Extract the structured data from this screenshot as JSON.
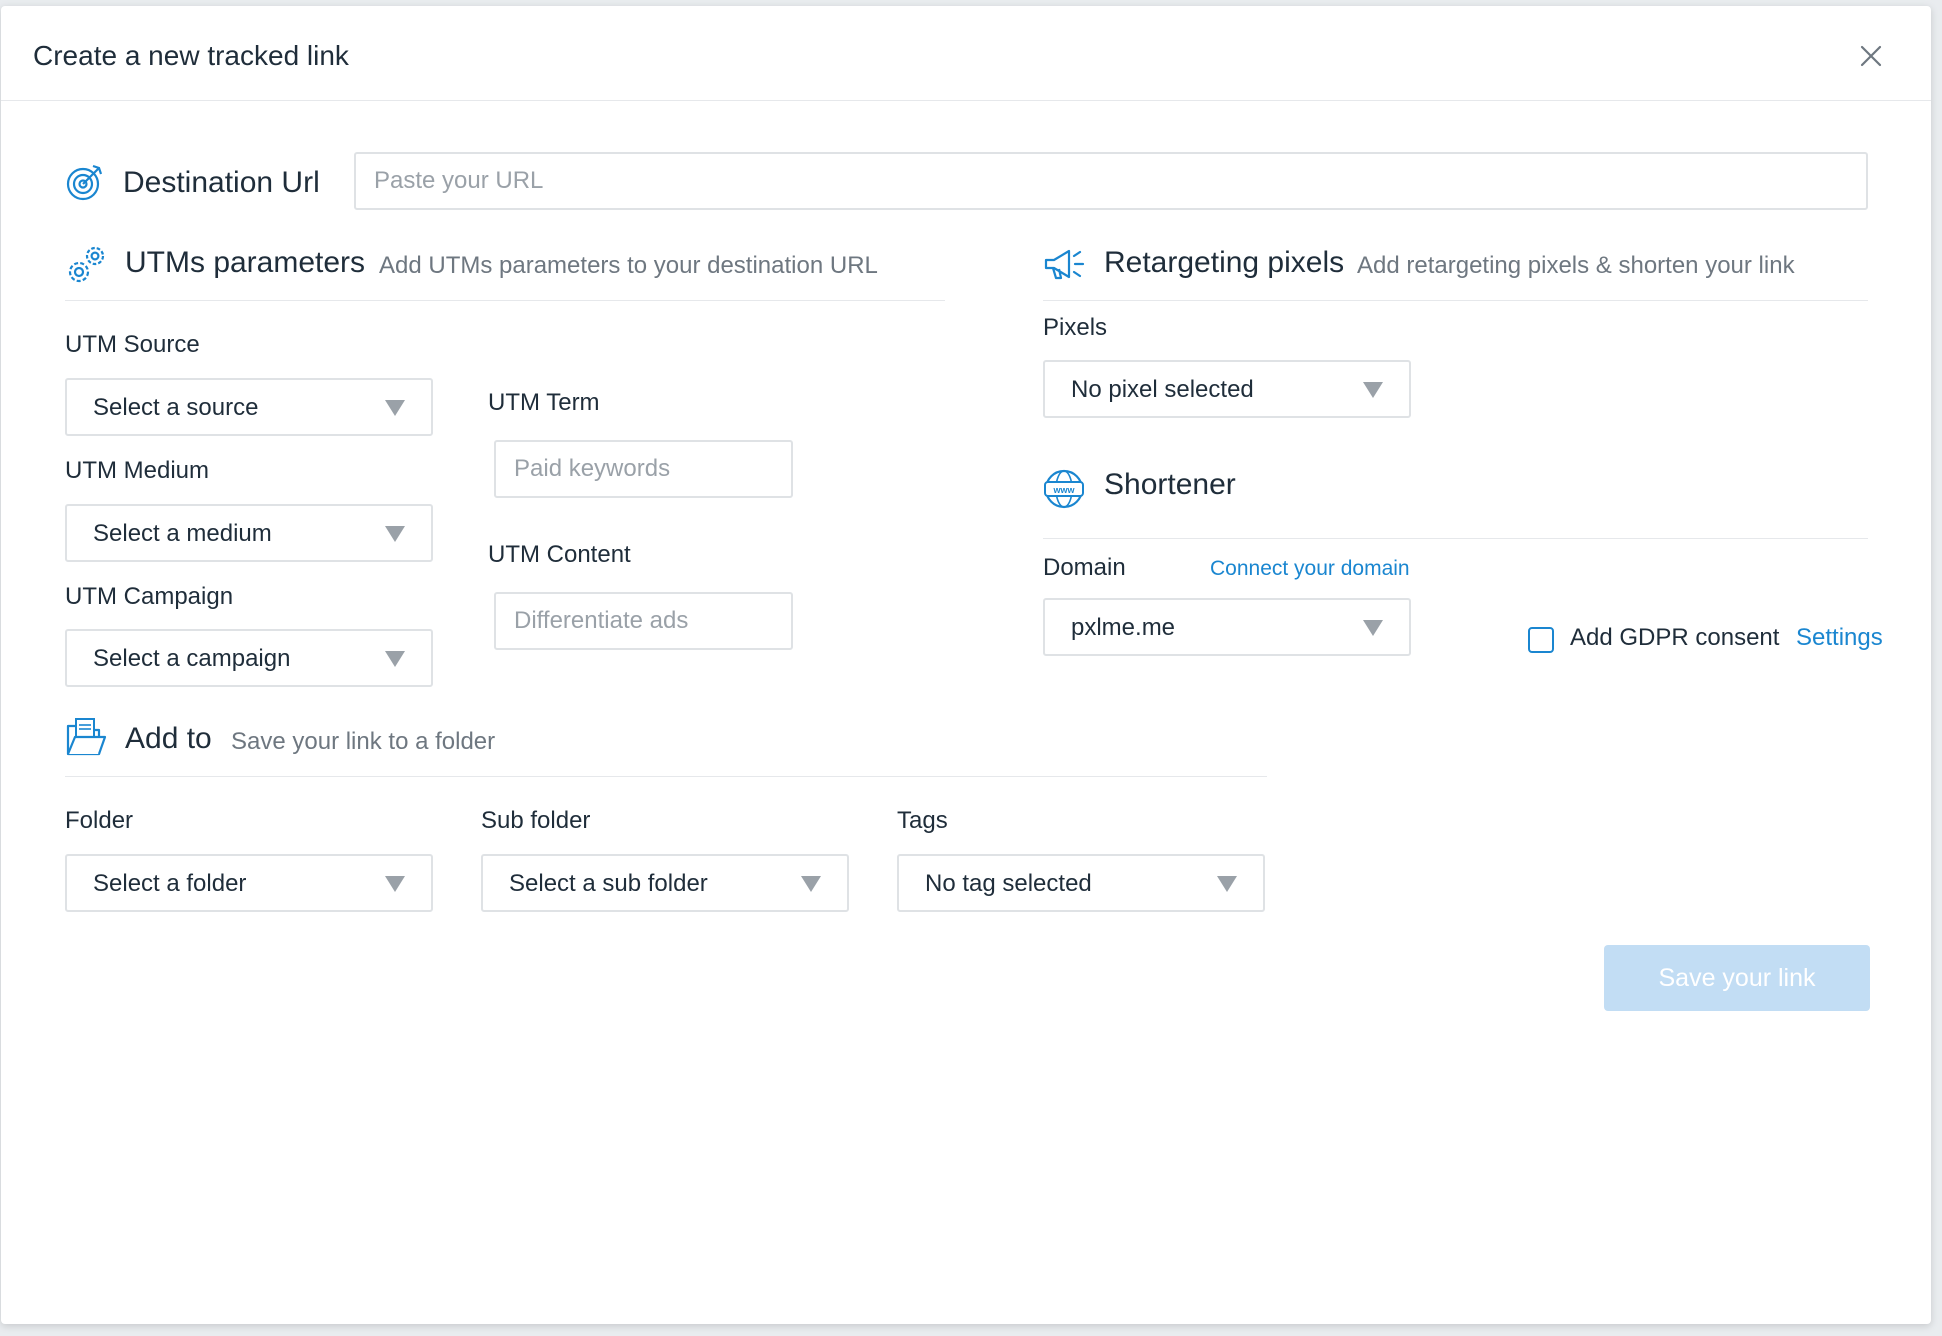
{
  "dialog": {
    "title": "Create a new tracked link"
  },
  "destination": {
    "label": "Destination Url",
    "placeholder": "Paste your URL",
    "icon": "target-icon"
  },
  "utm": {
    "title": "UTMs parameters",
    "subtitle": "Add UTMs parameters to your destination URL",
    "icon": "gears-icon",
    "source_label": "UTM Source",
    "source_value": "Select a source",
    "medium_label": "UTM Medium",
    "medium_value": "Select a medium",
    "campaign_label": "UTM Campaign",
    "campaign_value": "Select a campaign",
    "term_label": "UTM Term",
    "term_placeholder": "Paid keywords",
    "content_label": "UTM Content",
    "content_placeholder": "Differentiate ads"
  },
  "retargeting": {
    "title": "Retargeting pixels",
    "subtitle": "Add retargeting pixels & shorten your link",
    "icon": "megaphone-icon",
    "pixels_label": "Pixels",
    "pixels_value": "No pixel selected"
  },
  "shortener": {
    "title": "Shortener",
    "icon": "www-globe-icon",
    "domain_label": "Domain",
    "connect_link": "Connect your domain",
    "domain_value": "pxlme.me",
    "gdpr_label": "Add GDPR consent",
    "gdpr_checked": false,
    "settings_link": "Settings"
  },
  "add_to": {
    "title": "Add to",
    "subtitle": "Save your link to a folder",
    "icon": "folder-icon",
    "folder_label": "Folder",
    "folder_value": "Select a folder",
    "subfolder_label": "Sub folder",
    "subfolder_value": "Select a sub folder",
    "tags_label": "Tags",
    "tags_value": "No tag selected"
  },
  "actions": {
    "save_label": "Save your link"
  },
  "colors": {
    "accent": "#1a86d0",
    "save_disabled": "#c2ddf4",
    "text": "#1f2d3a",
    "muted": "#6e7780"
  }
}
